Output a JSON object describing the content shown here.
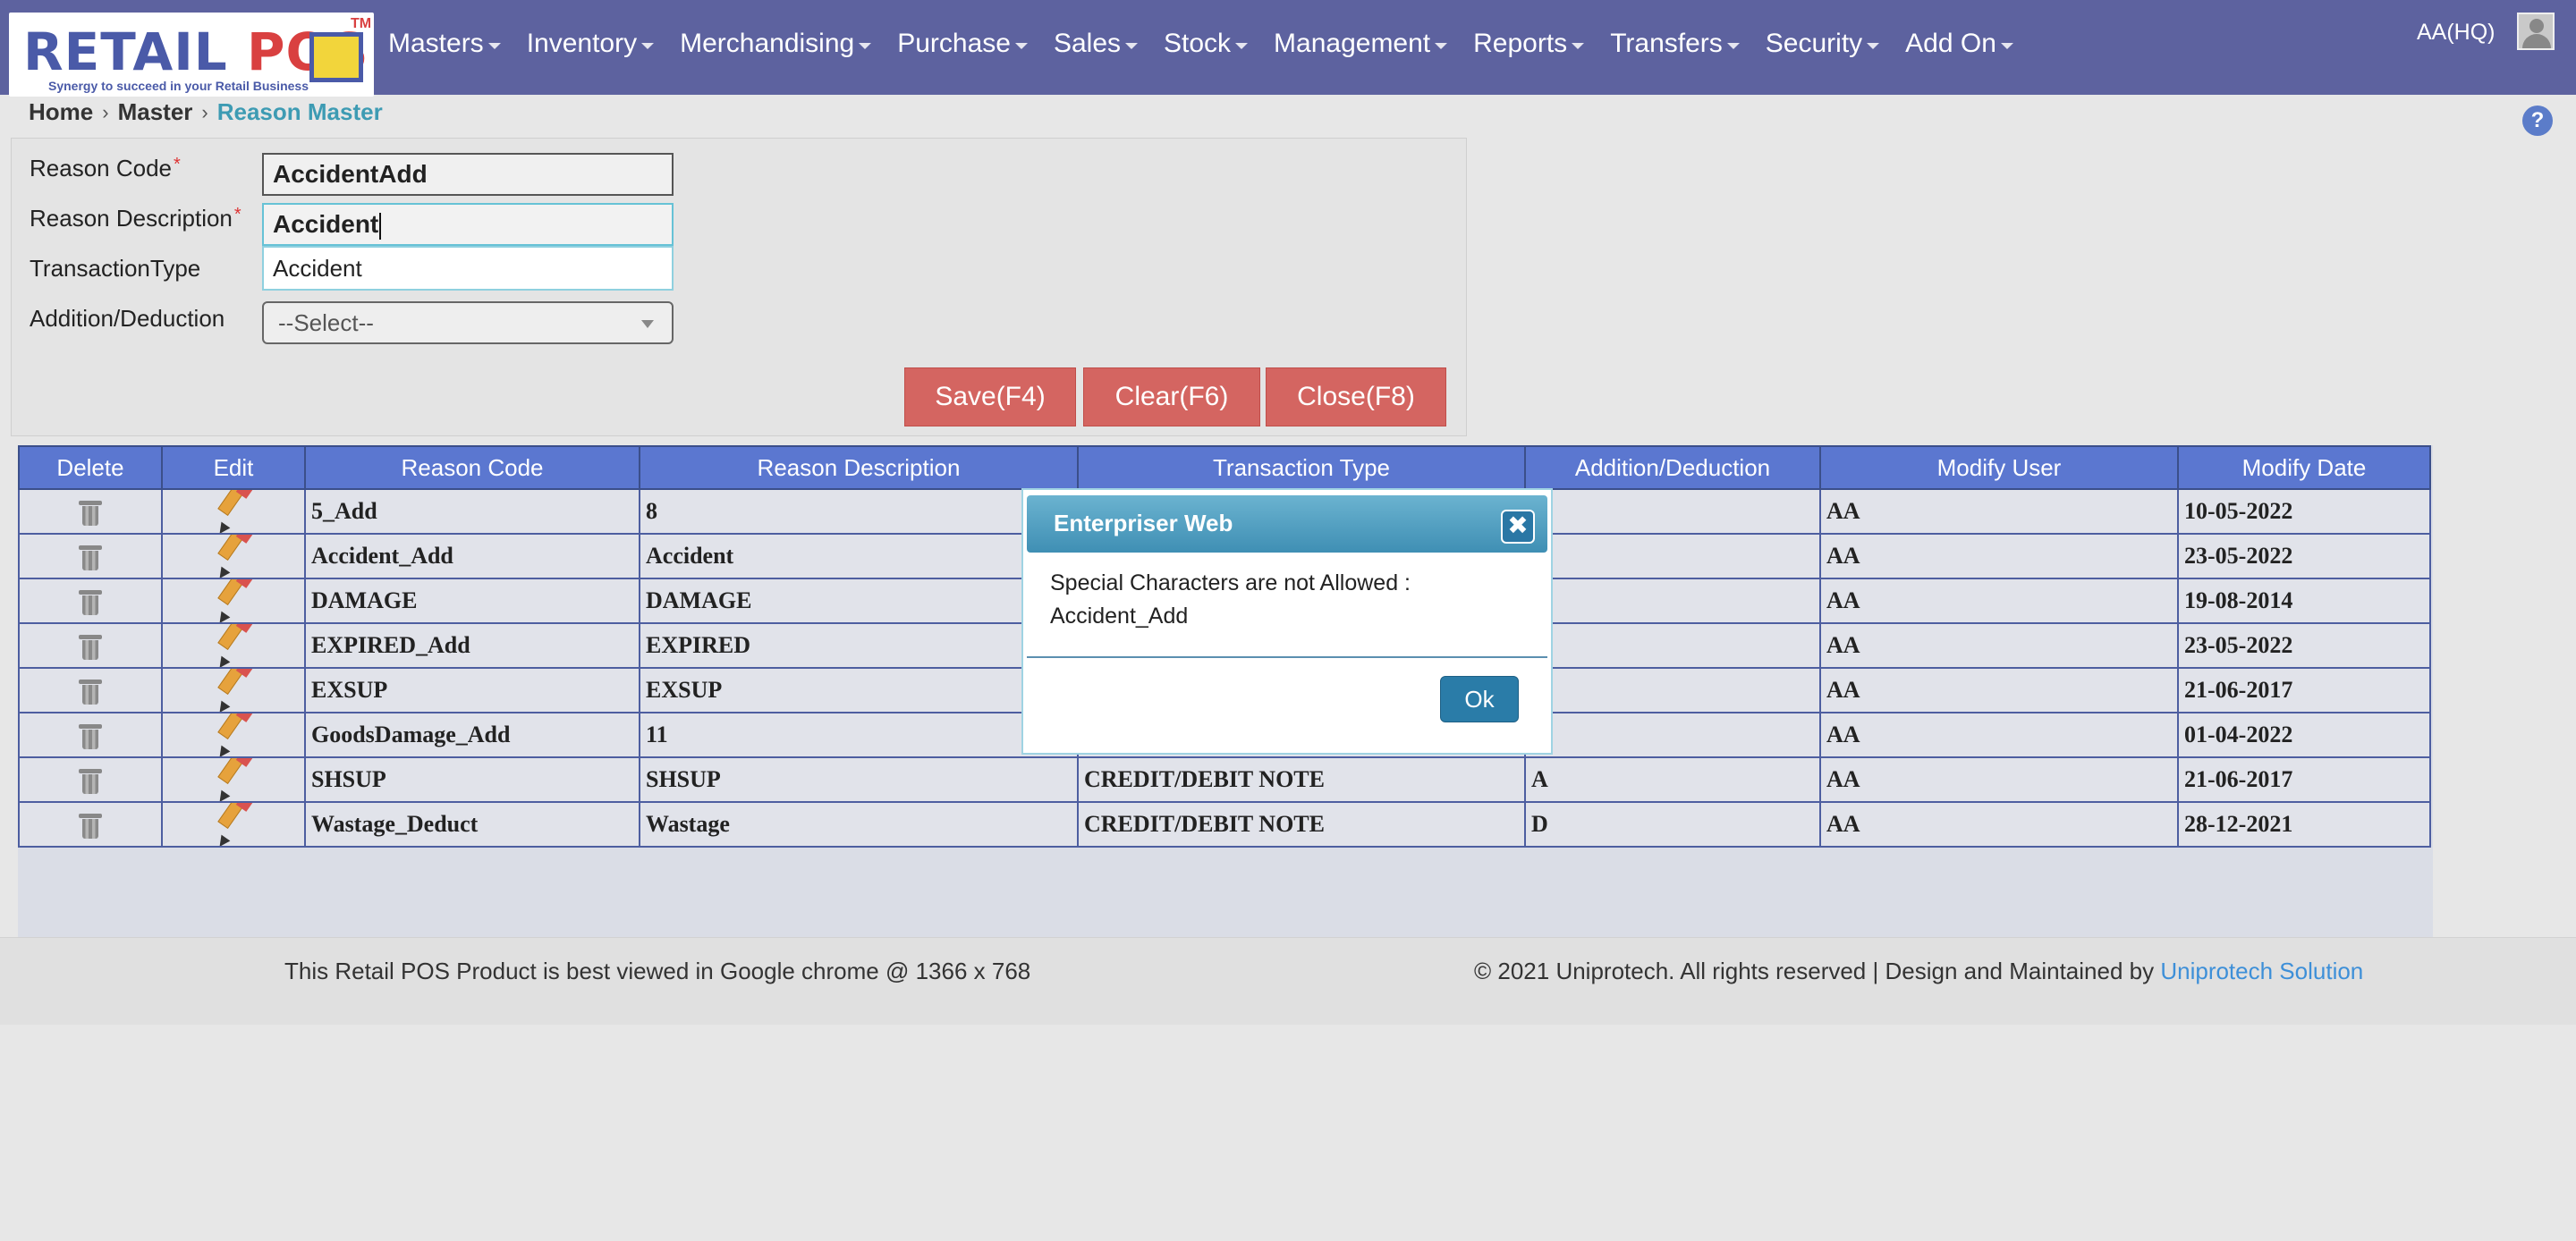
{
  "logo": {
    "text_a": "RETAIL",
    "text_b": "POS",
    "tm": "TM",
    "tagline": "Synergy to succeed in your Retail Business"
  },
  "nav": {
    "items": [
      "Masters",
      "Inventory",
      "Merchandising",
      "Purchase",
      "Sales",
      "Stock",
      "Management",
      "Reports",
      "Transfers",
      "Security",
      "Add On"
    ],
    "user": "AA(HQ)"
  },
  "breadcrumb": {
    "home": "Home",
    "master": "Master",
    "current": "Reason Master"
  },
  "form": {
    "reason_code_label": "Reason Code",
    "reason_code_value": "AccidentAdd",
    "reason_desc_label": "Reason Description",
    "reason_desc_value": "Accident",
    "autocomplete_option": "Accident",
    "transaction_type_label": "TransactionType",
    "addition_deduction_label": "Addition/Deduction",
    "addition_deduction_value": "--Select--",
    "required_mark": "*"
  },
  "buttons": {
    "save": "Save(F4)",
    "clear": "Clear(F6)",
    "close": "Close(F8)"
  },
  "table": {
    "headers": [
      "Delete",
      "Edit",
      "Reason Code",
      "Reason Description",
      "Transaction Type",
      "Addition/Deduction",
      "Modify User",
      "Modify Date"
    ],
    "rows": [
      [
        "5_Add",
        "8",
        "",
        "",
        "AA",
        "10-05-2022"
      ],
      [
        "Accident_Add",
        "Accident",
        "",
        "",
        "AA",
        "23-05-2022"
      ],
      [
        "DAMAGE",
        "DAMAGE",
        "",
        "",
        "AA",
        "19-08-2014"
      ],
      [
        "EXPIRED_Add",
        "EXPIRED",
        "",
        "",
        "AA",
        "23-05-2022"
      ],
      [
        "EXSUP",
        "EXSUP",
        "",
        "",
        "AA",
        "21-06-2017"
      ],
      [
        "GoodsDamage_Add",
        "11",
        "",
        "",
        "AA",
        "01-04-2022"
      ],
      [
        "SHSUP",
        "SHSUP",
        "CREDIT/DEBIT NOTE",
        "A",
        "AA",
        "21-06-2017"
      ],
      [
        "Wastage_Deduct",
        "Wastage",
        "CREDIT/DEBIT NOTE",
        "D",
        "AA",
        "28-12-2021"
      ]
    ]
  },
  "modal": {
    "title": "Enterpriser Web",
    "close": "✖",
    "message_line1": "Special Characters are not Allowed :",
    "message_line2": "Accident_Add",
    "ok": "Ok"
  },
  "footer": {
    "left": "This Retail POS Product is best viewed in Google chrome @ 1366 x 768",
    "right_text": "© 2021 Uniprotech. All rights reserved | Design and Maintained by",
    "right_link": "Uniprotech Solution"
  },
  "icons": {
    "help": "?",
    "trash": "trash-icon",
    "edit": "pencil-icon",
    "caret": "caret-down-icon",
    "avatar": "user-avatar-icon"
  }
}
